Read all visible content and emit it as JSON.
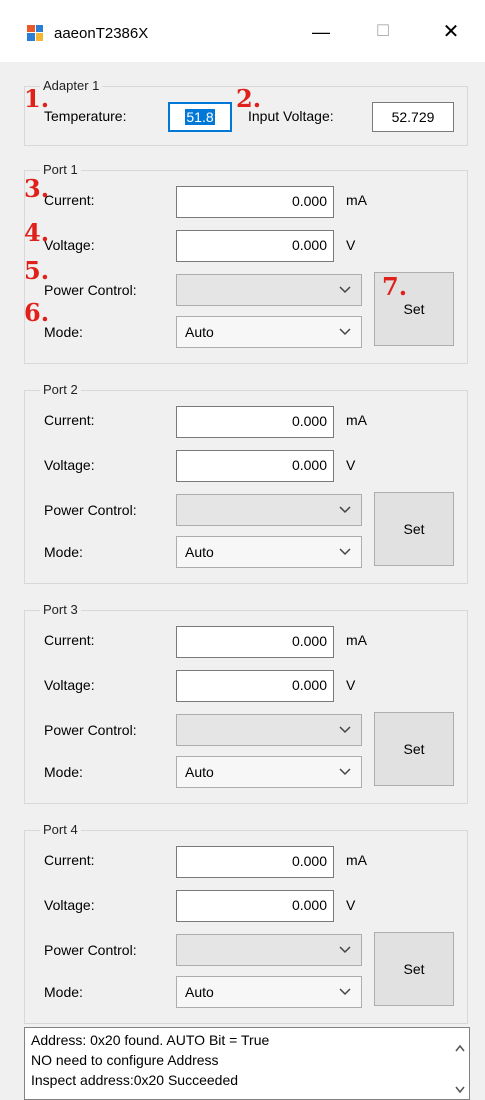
{
  "window": {
    "title": "aaeonT2386X",
    "minimize_glyph": "—",
    "maximize_glyph": "☐",
    "close_glyph": "✕"
  },
  "adapter": {
    "group_label": "Adapter 1",
    "temperature_label": "Temperature:",
    "temperature_value": "51.8",
    "input_voltage_label": "Input Voltage:",
    "input_voltage_value": "52.729"
  },
  "annotations": [
    "1.",
    "2.",
    "3.",
    "4.",
    "5.",
    "6.",
    "7."
  ],
  "labels": {
    "current": "Current:",
    "voltage": "Voltage:",
    "power_control": "Power Control:",
    "mode": "Mode:",
    "unit_current": "mA",
    "unit_voltage": "V",
    "set": "Set"
  },
  "ports": [
    {
      "group_label": "Port 1",
      "current": "0.000",
      "voltage": "0.000",
      "power_control": "",
      "mode": "Auto"
    },
    {
      "group_label": "Port 2",
      "current": "0.000",
      "voltage": "0.000",
      "power_control": "",
      "mode": "Auto"
    },
    {
      "group_label": "Port 3",
      "current": "0.000",
      "voltage": "0.000",
      "power_control": "",
      "mode": "Auto"
    },
    {
      "group_label": "Port 4",
      "current": "0.000",
      "voltage": "0.000",
      "power_control": "",
      "mode": "Auto"
    }
  ],
  "log": {
    "lines": [
      "Address: 0x20 found. AUTO Bit = True",
      "NO need to configure Address",
      "Inspect address:0x20 Succeeded"
    ],
    "scroll_up_glyph": "^",
    "scroll_down_glyph": "v"
  },
  "colors": {
    "annotation_red": "#e0201a",
    "selection_blue": "#0078d7"
  }
}
